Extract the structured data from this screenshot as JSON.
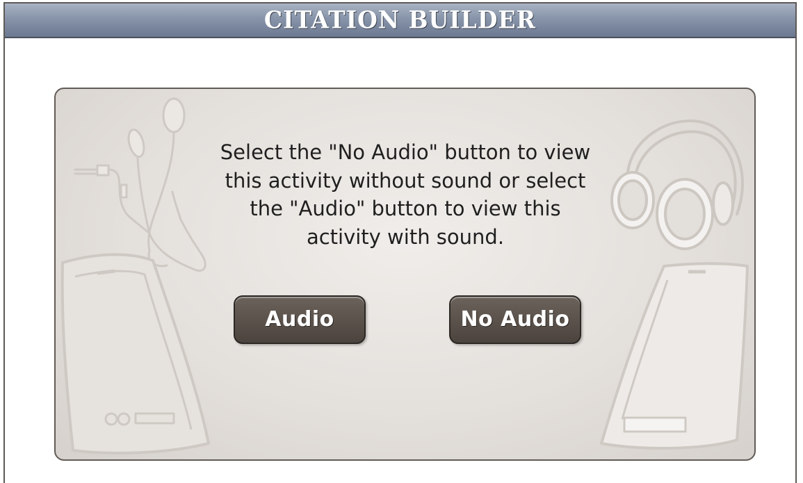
{
  "header": {
    "title": "CITATION BUILDER"
  },
  "dialog": {
    "message": "Select the \"No Audio\" button to view this activity without sound or select the \"Audio\" button to view this activity with sound.",
    "buttons": {
      "audio_label": "Audio",
      "no_audio_label": "No Audio"
    }
  },
  "colors": {
    "title_bar": "#8794a9",
    "button": "#5a514b",
    "panel_border": "#615b56",
    "panel_background": "#e4e0dc"
  },
  "icons": [
    "earbuds-icon",
    "headphones-icon",
    "speaker-left-icon",
    "speaker-right-icon"
  ]
}
